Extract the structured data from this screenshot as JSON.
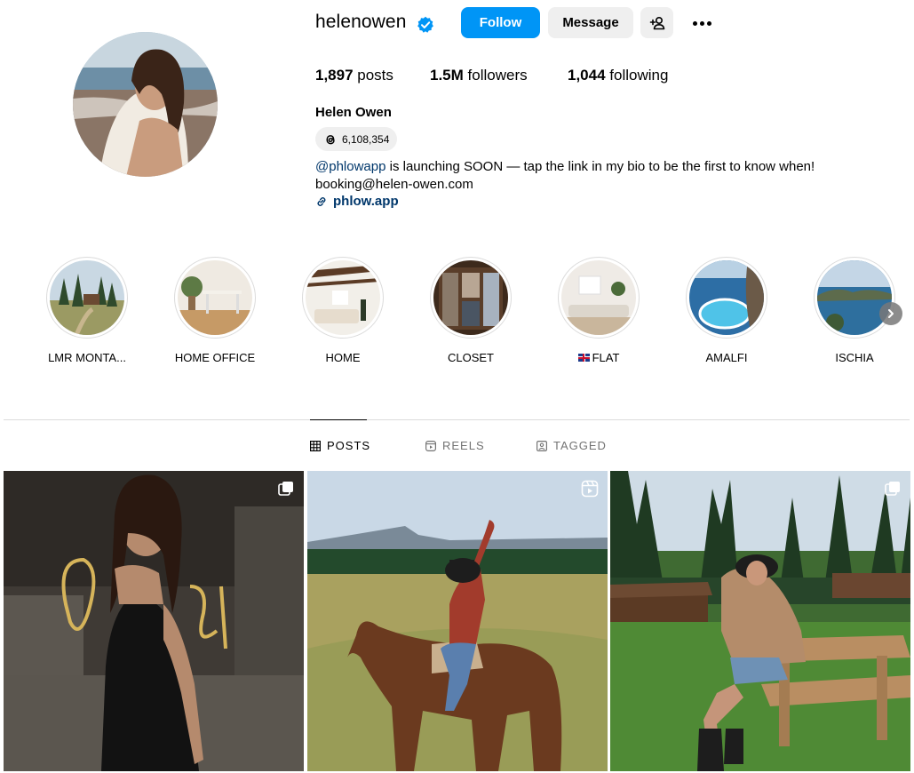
{
  "profile": {
    "username": "helenowen",
    "full_name": "Helen Owen",
    "threads_count": "6,108,354",
    "bio_mention": "@phlowapp",
    "bio_line1_rest": " is launching SOON — tap the link in my bio to be the first to know when!",
    "bio_line2": "booking@helen-owen.com",
    "link": "phlow.app"
  },
  "buttons": {
    "follow": "Follow",
    "message": "Message"
  },
  "stats": {
    "posts_count": "1,897",
    "posts_label": " posts",
    "followers_count": "1.5M",
    "followers_label": " followers",
    "following_count": "1,044",
    "following_label": " following"
  },
  "highlights": [
    {
      "label": "LMR MONTA..."
    },
    {
      "label": "HOME OFFICE"
    },
    {
      "label": "HOME"
    },
    {
      "label": "CLOSET"
    },
    {
      "label": "FLAT",
      "flag": "🇬🇧"
    },
    {
      "label": "AMALFI"
    },
    {
      "label": "ISCHIA"
    }
  ],
  "tabs": {
    "posts": "POSTS",
    "reels": "REELS",
    "tagged": "TAGGED"
  },
  "posts": [
    {
      "type_icon": "carousel-icon"
    },
    {
      "type_icon": "reel-icon"
    },
    {
      "type_icon": "carousel-icon"
    }
  ],
  "colors": {
    "accent": "#0095f6",
    "button_gray": "#efefef",
    "link": "#00376b",
    "verified": "#0095f6",
    "muted": "#737373"
  }
}
